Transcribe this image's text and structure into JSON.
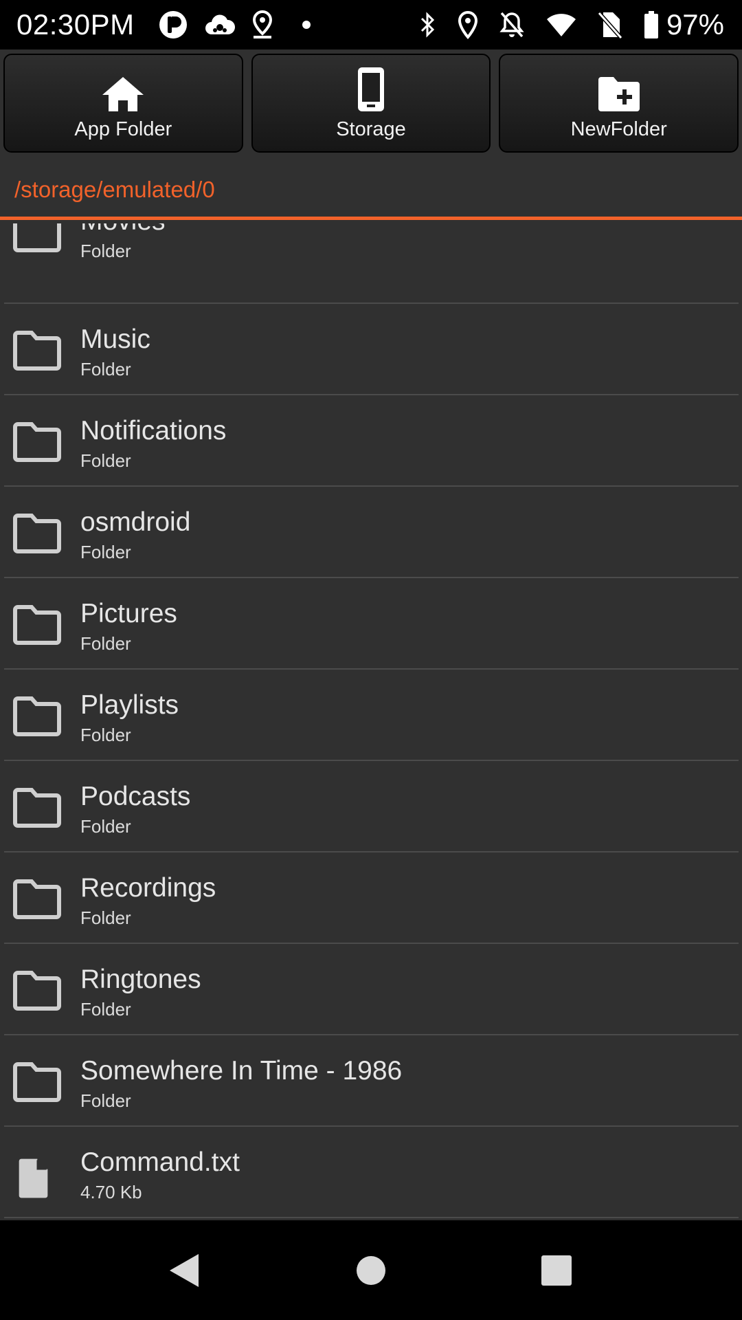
{
  "status_bar": {
    "time": "02:30PM",
    "battery": "97%",
    "icons": [
      "app-badge-icon",
      "cloud-icon",
      "location-pin-icon",
      "dot-icon",
      "bluetooth-icon",
      "location-icon",
      "notifications-off-icon",
      "wifi-icon",
      "no-sim-icon",
      "battery-icon"
    ]
  },
  "toolbar": {
    "app_folder": {
      "label": "App Folder",
      "icon": "home-icon"
    },
    "storage": {
      "label": "Storage",
      "icon": "phone-icon"
    },
    "new_folder": {
      "label": "NewFolder",
      "icon": "folder-plus-icon"
    }
  },
  "path": "/storage/emulated/0",
  "accent_color": "#f2622a",
  "items": [
    {
      "name": "Movies",
      "sub": "Folder",
      "type": "folder"
    },
    {
      "name": "Music",
      "sub": "Folder",
      "type": "folder"
    },
    {
      "name": "Notifications",
      "sub": "Folder",
      "type": "folder"
    },
    {
      "name": "osmdroid",
      "sub": "Folder",
      "type": "folder"
    },
    {
      "name": "Pictures",
      "sub": "Folder",
      "type": "folder"
    },
    {
      "name": "Playlists",
      "sub": "Folder",
      "type": "folder"
    },
    {
      "name": "Podcasts",
      "sub": "Folder",
      "type": "folder"
    },
    {
      "name": "Recordings",
      "sub": "Folder",
      "type": "folder"
    },
    {
      "name": "Ringtones",
      "sub": "Folder",
      "type": "folder"
    },
    {
      "name": "Somewhere In Time - 1986",
      "sub": "Folder",
      "type": "folder"
    },
    {
      "name": "Command.txt",
      "sub": "4.70 Kb",
      "type": "file"
    }
  ],
  "nav": {
    "icons": [
      "back-icon",
      "home-circle-icon",
      "recents-icon"
    ]
  }
}
